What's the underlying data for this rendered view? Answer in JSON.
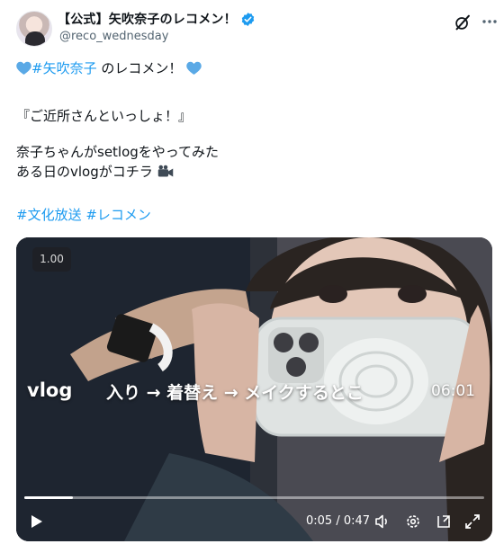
{
  "post": {
    "display_name": "【公式】矢吹奈子のレコメン！",
    "handle": "@reco_wednesday",
    "line1_hashtag": "#矢吹奈子",
    "line1_text": " のレコメン！",
    "line2": "『ご近所さんといっしょ！』",
    "line3": "奈子ちゃんがsetlogをやってみた",
    "line4": "ある日のvlogがコチラ",
    "hashtag1": "#文化放送",
    "hashtag2": "#レコメン"
  },
  "icons": {
    "verified": "verified-badge-icon",
    "grok": "grok-icon",
    "more": "more-icon",
    "heart": "blue-heart-icon",
    "camera": "video-camera-icon"
  },
  "video": {
    "speed": "1.00",
    "caption_vlog": "vlog",
    "caption_main": "入り → 着替え → メイクするとこ",
    "caption_time": "06:01",
    "time_current": "0:05",
    "time_total": "0:47",
    "progress_fraction": 0.106
  },
  "colors": {
    "accent": "#1d9bf0",
    "text": "#0f1419",
    "secondary": "#536471"
  }
}
